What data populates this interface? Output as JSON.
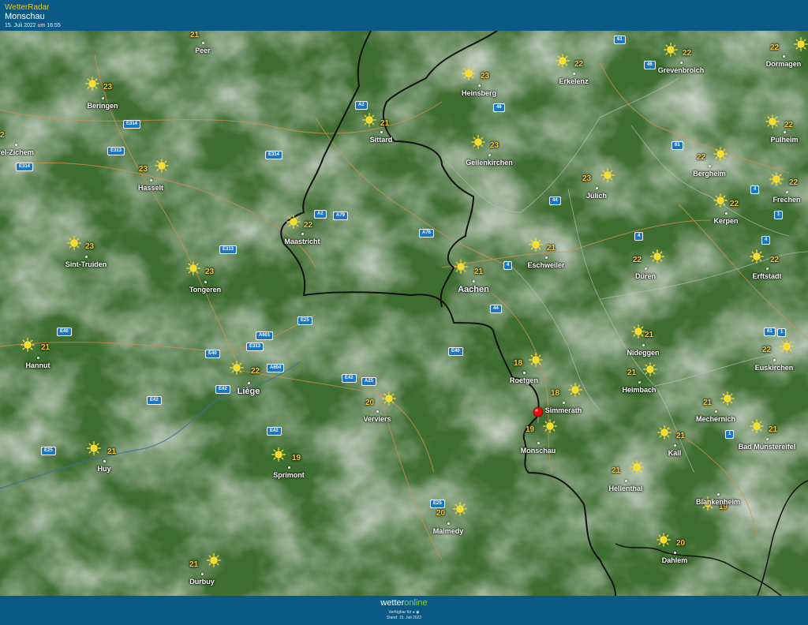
{
  "header": {
    "brand": "WetterRadar",
    "location": "Monschau",
    "datetime": "15. Juli 2022 um 16:55"
  },
  "footer": {
    "logo_part1": "wetter",
    "logo_part2": "online",
    "available": "Verfügbar für",
    "stand": "Stand: 15. Juli 2022"
  },
  "colors": {
    "bar": "#0b5a86",
    "forest": "#3b6b2e",
    "cloud": "#c9cbc8",
    "temp": "#f3c83a",
    "road_sign": "#1b76c5",
    "pin": "#e01010"
  },
  "cities": [
    {
      "name": "Peer",
      "temp": "21"
    },
    {
      "name": "Beringen",
      "temp": "23"
    },
    {
      "name": "Hasselt",
      "temp": "23"
    },
    {
      "name": "rel-Zichem",
      "temp": "2"
    },
    {
      "name": "Sint-Truiden",
      "temp": "23"
    },
    {
      "name": "Tongeren",
      "temp": "23"
    },
    {
      "name": "Hannut",
      "temp": "21"
    },
    {
      "name": "Liège",
      "temp": "22"
    },
    {
      "name": "Huy",
      "temp": "21"
    },
    {
      "name": "Durbuy",
      "temp": "21"
    },
    {
      "name": "Sprimont",
      "temp": "19"
    },
    {
      "name": "Verviers",
      "temp": "20"
    },
    {
      "name": "Malmedy",
      "temp": "20"
    },
    {
      "name": "Maastricht",
      "temp": "22"
    },
    {
      "name": "Sittard",
      "temp": "21"
    },
    {
      "name": "Heinsberg",
      "temp": "23"
    },
    {
      "name": "Geilenkirchen",
      "temp": "23"
    },
    {
      "name": "Erkelenz",
      "temp": "22"
    },
    {
      "name": "Aachen",
      "temp": "21"
    },
    {
      "name": "Eschweiler",
      "temp": "21"
    },
    {
      "name": "Jülich",
      "temp": "23"
    },
    {
      "name": "Roetgen",
      "temp": "18"
    },
    {
      "name": "Simmerath",
      "temp": "18"
    },
    {
      "name": "Monschau",
      "temp": "19"
    },
    {
      "name": "Düren",
      "temp": "22"
    },
    {
      "name": "Nideggen",
      "temp": "21"
    },
    {
      "name": "Heimbach",
      "temp": "21"
    },
    {
      "name": "Hellenthal",
      "temp": "21"
    },
    {
      "name": "Kall",
      "temp": "21"
    },
    {
      "name": "Mechernich",
      "temp": "21"
    },
    {
      "name": "Bad Münstereifel",
      "temp": "21"
    },
    {
      "name": "Blankenheim",
      "temp": "19"
    },
    {
      "name": "Dahlem",
      "temp": "20"
    },
    {
      "name": "Euskirchen",
      "temp": "22"
    },
    {
      "name": "Erftstadt",
      "temp": "22"
    },
    {
      "name": "Kerpen",
      "temp": "22"
    },
    {
      "name": "Bergheim",
      "temp": "22"
    },
    {
      "name": "Frechen",
      "temp": "22"
    },
    {
      "name": "Pulheim",
      "temp": "22"
    },
    {
      "name": "Grevenbroich",
      "temp": "22"
    },
    {
      "name": "Dormagen",
      "temp": "22"
    }
  ],
  "roads": [
    "61",
    "46",
    "46",
    "A2",
    "E314",
    "E313",
    "E314",
    "E314",
    "A2",
    "A79",
    "A76",
    "E313",
    "4",
    "4",
    "4",
    "44",
    "44",
    "61",
    "4",
    "1",
    "61",
    "1",
    "1",
    "A601",
    "E313",
    "E25",
    "E40",
    "E40",
    "E40",
    "E42",
    "A25",
    "A604",
    "E42",
    "E42",
    "E25",
    "E42",
    "E25"
  ],
  "icons": {
    "weather": "sun-icon",
    "marker": "location-pin-icon"
  }
}
